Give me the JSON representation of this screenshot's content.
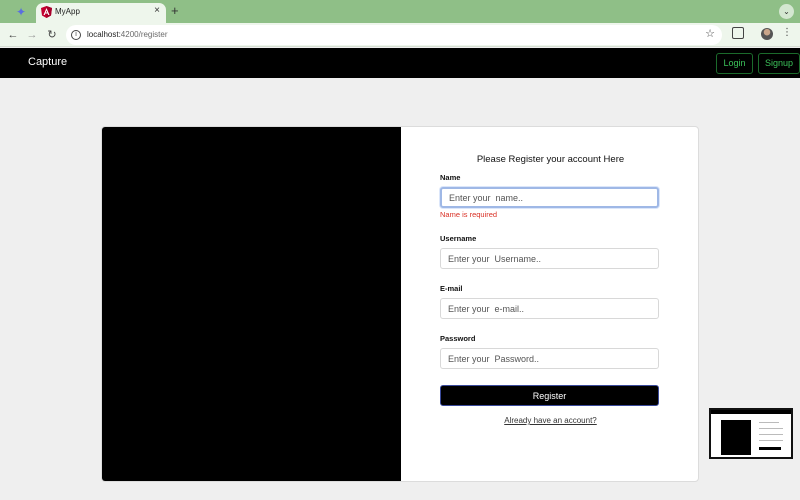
{
  "browser": {
    "tab_title": "MyApp",
    "tab_close": "×",
    "new_tab": "+",
    "url_host": "localhost:",
    "url_path": "4200/register",
    "icons": [
      "back-icon",
      "forward-icon",
      "reload-icon",
      "info-icon",
      "star-icon",
      "extensions-icon",
      "profile-icon",
      "kebab-menu-icon",
      "angular-favicon",
      "tab-search-icon"
    ]
  },
  "nav": {
    "brand": "Capture",
    "login": "Login",
    "signup": "Signup"
  },
  "form": {
    "title": "Please Register your account Here",
    "name_label": "Name",
    "name_placeholder": "Enter your  name..",
    "name_error": "Name is required",
    "username_label": "Username",
    "username_placeholder": "Enter your  Username..",
    "email_label": "E-mail",
    "email_placeholder": "Enter your  e-mail..",
    "password_label": "Password",
    "password_placeholder": "Enter your  Password..",
    "submit": "Register",
    "login_link": "Already have an account?"
  },
  "colors": {
    "accent_green": "#3cc25a",
    "error_red": "#d93025",
    "focus_blue": "#9fb8e6"
  }
}
